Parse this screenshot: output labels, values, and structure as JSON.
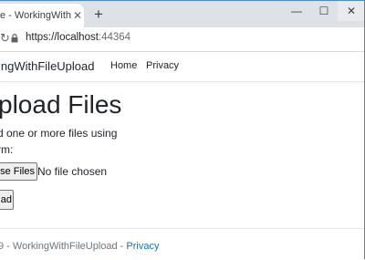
{
  "browser": {
    "tab_title": "e - WorkingWithFileUp",
    "tab_close": "✕",
    "new_tab": "+",
    "url_main": "https://localhost",
    "url_port": ":44364"
  },
  "navbar": {
    "brand": "ingWithFileUpload",
    "links": [
      "Home",
      "Privacy"
    ]
  },
  "main": {
    "title": "pload Files",
    "description": "d one or more files using rm:",
    "choose_button": "se Files",
    "no_file_text": "No file chosen",
    "upload_button": "ad"
  },
  "footer": {
    "prefix": "9 - WorkingWithFileUpload - ",
    "privacy_link": "Privacy"
  }
}
